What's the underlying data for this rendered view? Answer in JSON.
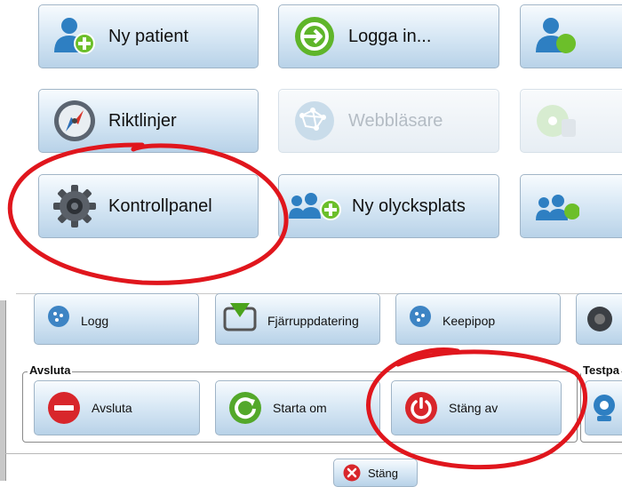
{
  "top_panel": {
    "buttons": [
      {
        "label": "Ny patient",
        "icon": "add-user-icon"
      },
      {
        "label": "Logga in...",
        "icon": "login-icon"
      },
      {
        "label": "Riktlinjer",
        "icon": "compass-icon"
      },
      {
        "label": "Webbläsare",
        "icon": "globe-network-icon",
        "disabled": true
      },
      {
        "label": "Kontrollpanel",
        "icon": "gear-icon"
      },
      {
        "label": "Ny olycksplats",
        "icon": "add-group-icon"
      }
    ]
  },
  "bottom_panel": {
    "top_row": [
      "Logg",
      "Fjärruppdatering",
      "Keepipop"
    ],
    "avsluta_group": {
      "legend": "Avsluta",
      "buttons": [
        {
          "label": "Avsluta",
          "icon": "stop-icon"
        },
        {
          "label": "Starta om",
          "icon": "restart-icon"
        },
        {
          "label": "Stäng av",
          "icon": "power-icon"
        }
      ]
    },
    "test_group": {
      "legend": "Testpa"
    },
    "close_button": {
      "label": "Stäng",
      "icon": "close-icon"
    }
  },
  "colors": {
    "annotation": "#e0161d",
    "button_border": "#9fb4c7"
  }
}
